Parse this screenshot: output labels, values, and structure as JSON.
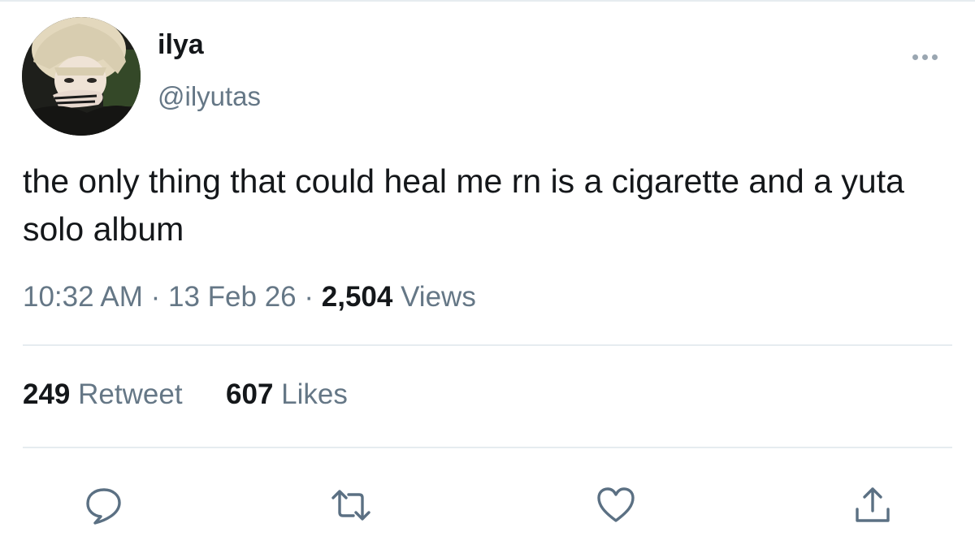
{
  "user": {
    "display_name": "ilya",
    "handle": "@ilyutas"
  },
  "tweet": {
    "text": "the only thing that could heal me rn is a cigarette and a yuta solo album"
  },
  "meta": {
    "time": "10:32 AM",
    "separator": "·",
    "date": "13 Feb 26",
    "views_count": "2,504",
    "views_label": "Views"
  },
  "stats": {
    "retweets_count": "249",
    "retweets_label": "Retweet",
    "likes_count": "607",
    "likes_label": "Likes"
  },
  "actions": {
    "reply_icon": "reply-icon",
    "retweet_icon": "retweet-icon",
    "like_icon": "heart-icon",
    "share_icon": "share-icon"
  },
  "colors": {
    "primary_text": "#14171a",
    "secondary_text": "#657786",
    "divider": "#e6ecf0",
    "icon": "#5b7083"
  }
}
